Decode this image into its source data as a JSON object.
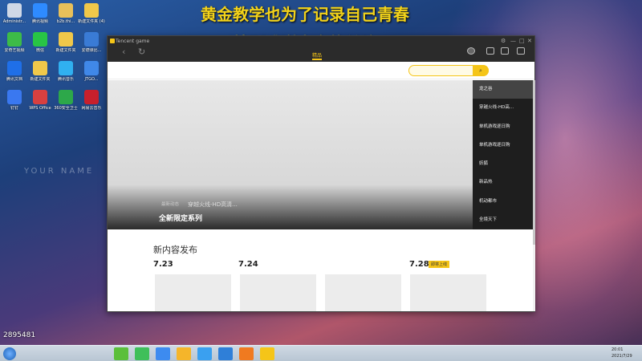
{
  "banner": {
    "line1": "黄金教学也为了记录自己青春",
    "line2": "特别感谢大家的关注"
  },
  "watermark": "YOUR NAME",
  "stream_id": "2895481",
  "desktop_icons": [
    {
      "label": "Administr...",
      "color": "#cfd8e6"
    },
    {
      "label": "腾讯视频",
      "color": "#2e8bff"
    },
    {
      "label": "b2b.thi...",
      "color": "#e8c05a"
    },
    {
      "label": "新建文件夹 (4)",
      "color": "#f0c84a"
    },
    {
      "label": "爱奇艺视频",
      "color": "#3dbb48"
    },
    {
      "label": "微信",
      "color": "#28c445"
    },
    {
      "label": "新建文件夹",
      "color": "#f0c84a"
    },
    {
      "label": "爱德课比...",
      "color": "#3a7bd5"
    },
    {
      "label": "腾讯文档",
      "color": "#1f6fe8"
    },
    {
      "label": "新建文件夹",
      "color": "#f0c84a"
    },
    {
      "label": "腾讯音乐",
      "color": "#30b0f0"
    },
    {
      "label": "JTGO...",
      "color": "#4088e8"
    },
    {
      "label": "钉钉",
      "color": "#3a78f0"
    },
    {
      "label": "WPS Office",
      "color": "#d84040"
    },
    {
      "label": "360安全卫士",
      "color": "#2da84a"
    },
    {
      "label": "网易云音乐",
      "color": "#c8202c"
    }
  ],
  "window": {
    "app_title": "Tencent game",
    "back_icon": "‹",
    "refresh_icon": "↻",
    "center_tab": "精品",
    "controls": {
      "settings": "⚙",
      "minimize": "—",
      "maximize": "□",
      "close": "✕"
    }
  },
  "search": {
    "placeholder": "",
    "button_icon": "⌕"
  },
  "hero": {
    "tag": "最新动态",
    "subtitle": "穿越火线-HD高清...",
    "title": "全新限定系列"
  },
  "side_menu": [
    {
      "label": "龙之谷",
      "active": true
    },
    {
      "label": "穿越火线-HD高...",
      "active": false
    },
    {
      "label": "单机游戏逐日购",
      "active": false
    },
    {
      "label": "单机游戏逐日购",
      "active": false
    },
    {
      "label": "妖狐",
      "active": false
    },
    {
      "label": "新品热",
      "active": false
    },
    {
      "label": "机动都市",
      "active": false
    },
    {
      "label": "全境天下",
      "active": false
    }
  ],
  "new_content": {
    "title": "新内容发布",
    "dates": [
      {
        "label": "7.23"
      },
      {
        "label": "7.24"
      },
      {
        "label": "7.28",
        "badge": "即将上线"
      }
    ]
  },
  "taskbar": {
    "time": "20:01",
    "date": "2021/7/29",
    "icons": [
      {
        "name": "green-app",
        "color": "#5bbf3a"
      },
      {
        "name": "wechat",
        "color": "#3fbf5a"
      },
      {
        "name": "baidu-netdisk",
        "color": "#3d8bf0"
      },
      {
        "name": "qq-music",
        "color": "#f5b52a"
      },
      {
        "name": "kugou",
        "color": "#3aa0f0"
      },
      {
        "name": "ie-browser",
        "color": "#2f7fd8"
      },
      {
        "name": "orange-app",
        "color": "#f07a20"
      },
      {
        "name": "tencent-game",
        "color": "#f5c518"
      }
    ]
  }
}
